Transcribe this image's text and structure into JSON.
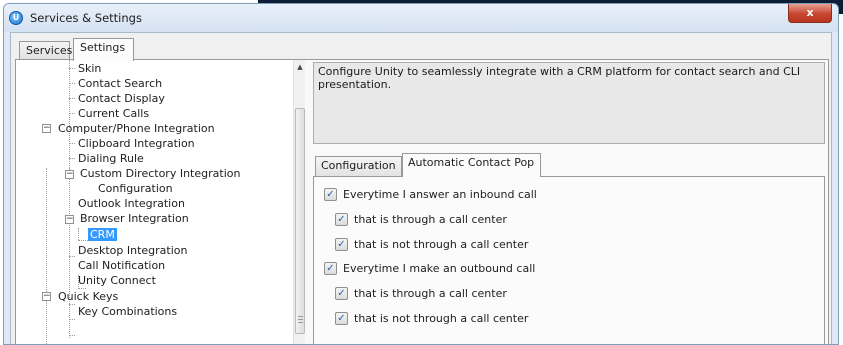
{
  "window": {
    "title": "Services & Settings",
    "close_label": "x",
    "app_icon_glyph": "U"
  },
  "main_tabs": [
    {
      "label": "Services",
      "active": false
    },
    {
      "label": "Settings",
      "active": true
    }
  ],
  "tree": {
    "selected": "CRM",
    "items": {
      "skin": "Skin",
      "contact_search": "Contact Search",
      "contact_display": "Contact Display",
      "current_calls": "Current Calls",
      "cpi": "Computer/Phone Integration",
      "clipboard": "Clipboard Integration",
      "dialing": "Dialing Rule",
      "custom_dir": "Custom Directory Integration",
      "configuration": "Configuration",
      "outlook": "Outlook Integration",
      "browser": "Browser Integration",
      "crm": "CRM",
      "desktop": "Desktop Integration",
      "call_notification": "Call Notification",
      "unity_connect": "Unity Connect",
      "quick_keys": "Quick Keys",
      "key_combinations": "Key Combinations"
    },
    "expander_glyph": "−"
  },
  "description": "Configure Unity to seamlessly integrate with a CRM platform for contact search and CLI presentation.",
  "inner_tabs": [
    {
      "label": "Configuration",
      "active": false
    },
    {
      "label": "Automatic Contact Pop",
      "active": true
    }
  ],
  "options": {
    "inbound": {
      "label": "Everytime I answer an inbound call",
      "checked": true
    },
    "inbound_cc": {
      "label": "that is through a call center",
      "checked": true
    },
    "inbound_not_cc": {
      "label": "that is not through a call center",
      "checked": true
    },
    "outbound": {
      "label": "Everytime I make an outbound call",
      "checked": true
    },
    "outbound_cc": {
      "label": "that is through a call center",
      "checked": true
    },
    "outbound_not_cc": {
      "label": "that is not through a call center",
      "checked": true
    }
  },
  "check_glyph": "✓",
  "colors": {
    "selection": "#3399ff",
    "titlebar": "#d4e1f1",
    "close_button": "#c8452f"
  }
}
